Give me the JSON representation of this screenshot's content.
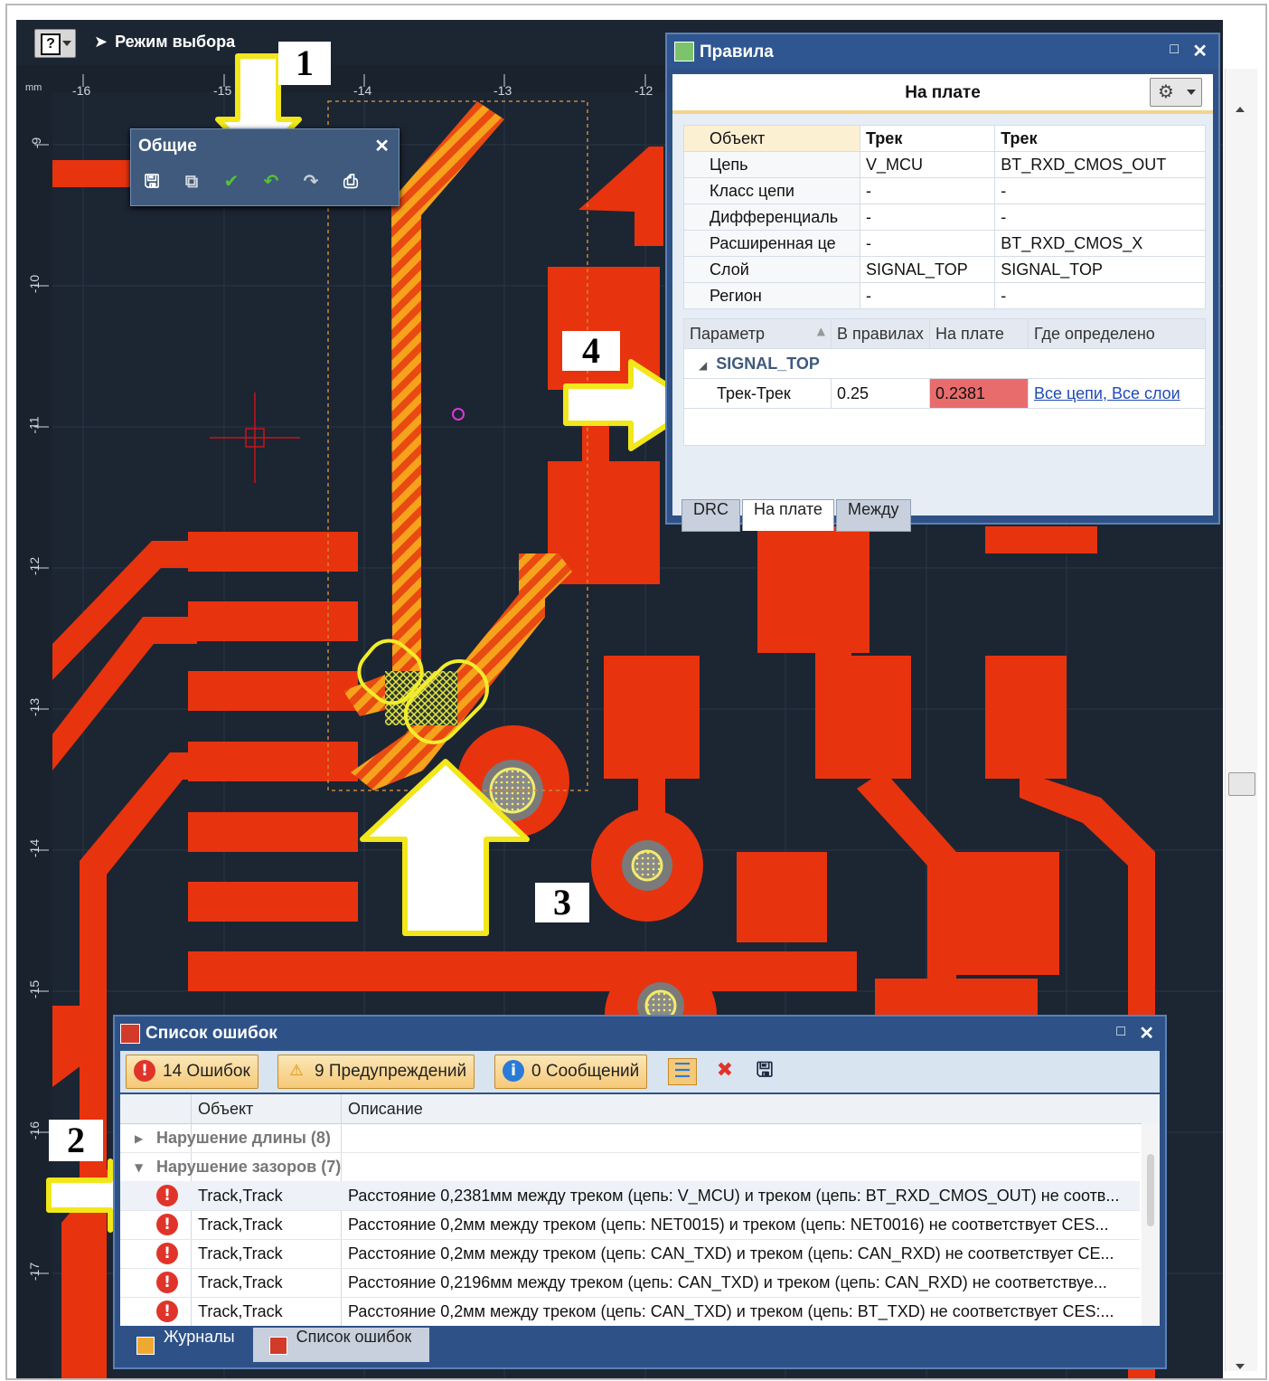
{
  "toolbar": {
    "mode_label": "Режим выбора"
  },
  "ruler": {
    "unit": "mm",
    "x_ticks": [
      "-16",
      "-15",
      "-14",
      "-13",
      "-12"
    ],
    "y_ticks": [
      "-9",
      "-10",
      "-11",
      "-12",
      "-13",
      "-14",
      "-15",
      "-16",
      "-17"
    ]
  },
  "common_toolbar": {
    "title": "Общие"
  },
  "rules_panel": {
    "title": "Правила",
    "subtitle": "На плате",
    "objects": [
      {
        "label": "Объект",
        "a": "Трек",
        "b": "Трек"
      },
      {
        "label": "Цепь",
        "a": "V_MCU",
        "b": "BT_RXD_CMOS_OUT"
      },
      {
        "label": "Класс цепи",
        "a": "-",
        "b": "-"
      },
      {
        "label": "Дифференциаль",
        "a": "-",
        "b": "-"
      },
      {
        "label": "Расширенная це",
        "a": "-",
        "b": "BT_RXD_CMOS_X"
      },
      {
        "label": "Слой",
        "a": "SIGNAL_TOP",
        "b": "SIGNAL_TOP"
      },
      {
        "label": "Регион",
        "a": "-",
        "b": "-"
      }
    ],
    "param_headers": {
      "param": "Параметр",
      "in_rules": "В правилах",
      "on_board": "На плате",
      "defined": "Где определено"
    },
    "group": "SIGNAL_TOP",
    "param_row": {
      "param": "Трек-Трек",
      "in_rules": "0.25",
      "on_board": "0.2381",
      "defined": "Все цепи, Все слои"
    },
    "tabs": [
      "DRC",
      "На плате",
      "Между"
    ],
    "active_tab": "На плате"
  },
  "error_list": {
    "title": "Список ошибок",
    "filters": {
      "errors": "14 Ошибок",
      "warnings": "9 Предупреждений",
      "messages": "0 Сообщений"
    },
    "columns": {
      "object": "Объект",
      "description": "Описание"
    },
    "groups": [
      {
        "label": "Нарушение длины (8)"
      },
      {
        "label": "Нарушение зазоров (7)"
      }
    ],
    "rows": [
      {
        "object": "Track,Track",
        "description": "Расстояние 0,2381мм между треком (цепь: V_MCU) и треком (цепь: BT_RXD_CMOS_OUT) не соотв..."
      },
      {
        "object": "Track,Track",
        "description": "Расстояние 0,2мм между треком (цепь: NET0015) и треком (цепь: NET0016) не соответствует CES..."
      },
      {
        "object": "Track,Track",
        "description": "Расстояние 0,2мм между треком (цепь: CAN_TXD) и треком (цепь: CAN_RXD) не соответствует CE..."
      },
      {
        "object": "Track,Track",
        "description": "Расстояние 0,2196мм между треком (цепь: CAN_TXD) и треком (цепь: CAN_RXD) не соответствуе..."
      },
      {
        "object": "Track,Track",
        "description": "Расстояние 0,2мм между треком (цепь: CAN_TXD) и треком (цепь: BT_TXD) не соответствует CES:..."
      }
    ],
    "bottom_tabs": [
      "Журналы",
      "Список ошибок"
    ]
  },
  "callouts": [
    "1",
    "2",
    "3",
    "4"
  ]
}
